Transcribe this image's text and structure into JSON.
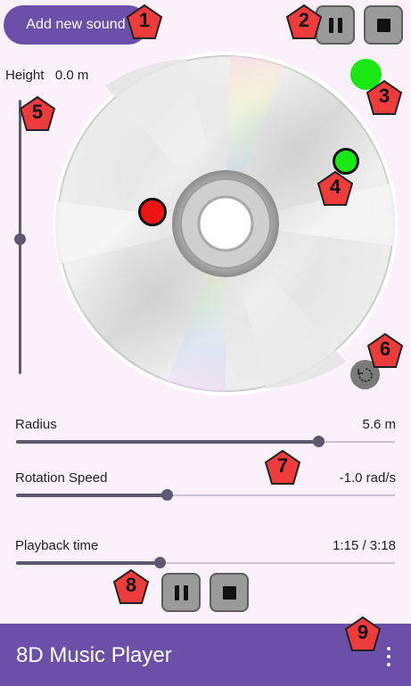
{
  "header": {
    "add_sound_label": "Add new sound"
  },
  "height": {
    "label": "Height",
    "value": "0.0 m",
    "slider_fraction": 0.5
  },
  "sliders": {
    "radius": {
      "label": "Radius",
      "value": "5.6 m",
      "fraction": 0.8
    },
    "rotation_speed": {
      "label": "Rotation Speed",
      "value": "-1.0 rad/s",
      "fraction": 0.4
    },
    "playback": {
      "label": "Playback time",
      "value": "1:15 / 3:18",
      "fraction": 0.38
    }
  },
  "app_bar": {
    "title": "8D Music Player"
  },
  "badges": [
    "1",
    "2",
    "3",
    "4",
    "5",
    "6",
    "7",
    "8",
    "9"
  ],
  "colors": {
    "accent": "#6c4fa8",
    "background": "#fbf1fb",
    "listener_dot": "#19e812",
    "source_dot": "#ee1515",
    "badge_fill": "#ee3b3b"
  },
  "icons": {
    "pause": "pause-icon",
    "stop": "stop-icon",
    "reset": "reset-rotation-icon",
    "menu": "more-vert-icon"
  }
}
